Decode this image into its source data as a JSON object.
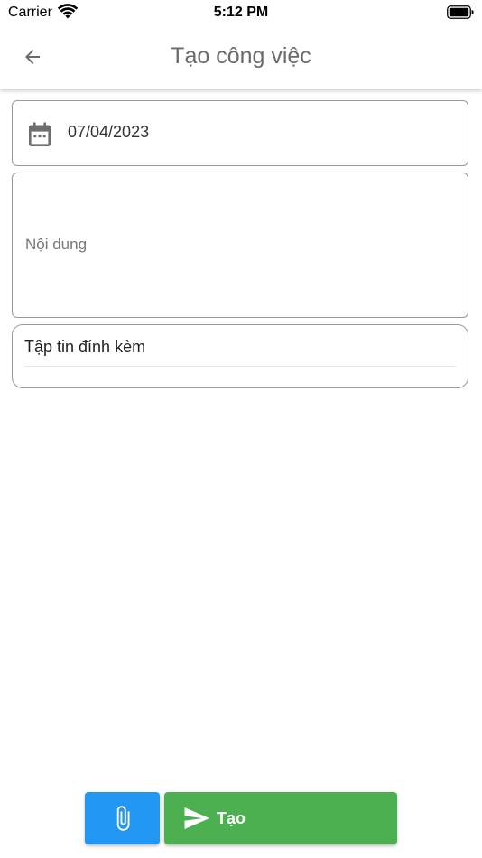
{
  "status_bar": {
    "carrier": "Carrier",
    "time": "5:12 PM"
  },
  "app_bar": {
    "title": "Tạo công việc",
    "back_icon": "arrow-back-icon"
  },
  "form": {
    "date": {
      "icon": "calendar-icon",
      "value": "07/04/2023"
    },
    "content": {
      "placeholder": "Nội dung",
      "value": ""
    },
    "attachments": {
      "label": "Tập tin đính kèm"
    }
  },
  "actions": {
    "attach_icon": "paperclip-icon",
    "create_icon": "send-icon",
    "create_label": "Tạo"
  },
  "colors": {
    "attach_button": "#2196f3",
    "create_button": "#4caf50",
    "title_text": "#6b6b6b"
  }
}
